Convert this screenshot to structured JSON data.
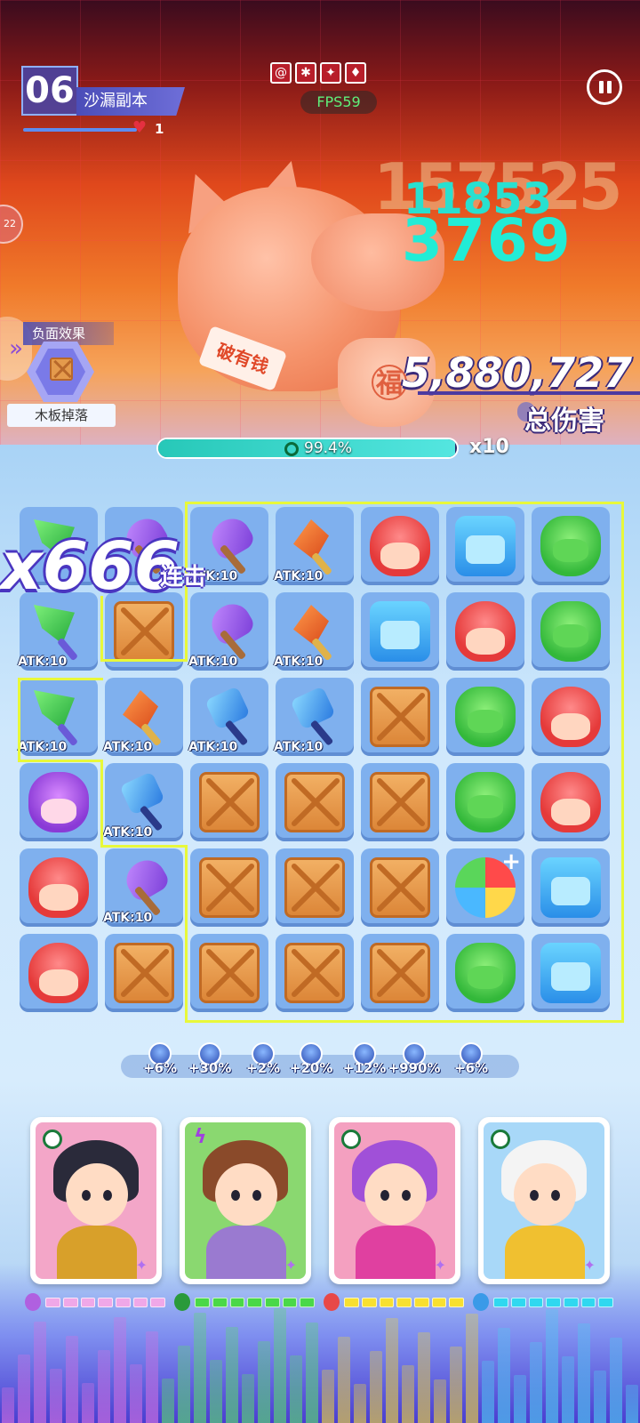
{
  "header": {
    "level_number": "06",
    "stage_name": "沙漏副本",
    "flame_count": "1",
    "element_icons": [
      "tornado-icon",
      "snowflake-icon",
      "fire-burst-icon",
      "flame-icon"
    ],
    "fps": "FPS59",
    "pause_icon": "pause-icon"
  },
  "boss": {
    "scroll_text": "破有钱",
    "bag_text": "福",
    "ghost_damage": "157525",
    "damage_hit_1": "11853",
    "damage_hit_2": "3769",
    "total_damage": "5,880,727",
    "total_damage_label": "总伤害",
    "side_timer": "22"
  },
  "debuff": {
    "title": "负面效果",
    "name": "木板掉落",
    "icon": "wooden-crate-icon"
  },
  "hp": {
    "percent_text": "99.4%",
    "fill_fraction": 0.994,
    "multiplier": "x10"
  },
  "combo": {
    "count": "x666",
    "label": "连击"
  },
  "grid": {
    "rows": [
      [
        {
          "type": "sword-green",
          "atk": ""
        },
        {
          "type": "axe",
          "atk": ""
        },
        {
          "type": "axe",
          "atk": "ATK:10"
        },
        {
          "type": "sword-orange",
          "atk": "ATK:10"
        },
        {
          "type": "red",
          "atk": ""
        },
        {
          "type": "blue",
          "atk": ""
        },
        {
          "type": "green",
          "atk": ""
        }
      ],
      [
        {
          "type": "sword-green",
          "atk": "ATK:10"
        },
        {
          "type": "crate",
          "atk": ""
        },
        {
          "type": "axe",
          "atk": "ATK:10"
        },
        {
          "type": "sword-orange",
          "atk": "ATK:10"
        },
        {
          "type": "blue",
          "atk": ""
        },
        {
          "type": "red",
          "atk": ""
        },
        {
          "type": "green",
          "atk": ""
        }
      ],
      [
        {
          "type": "sword-green",
          "atk": "ATK:10"
        },
        {
          "type": "sword-orange",
          "atk": "ATK:10"
        },
        {
          "type": "hammer",
          "atk": "ATK:10"
        },
        {
          "type": "hammer",
          "atk": "ATK:10"
        },
        {
          "type": "crate",
          "atk": ""
        },
        {
          "type": "green",
          "atk": ""
        },
        {
          "type": "red",
          "atk": ""
        }
      ],
      [
        {
          "type": "purple",
          "atk": ""
        },
        {
          "type": "hammer",
          "atk": "ATK:10"
        },
        {
          "type": "crate",
          "atk": ""
        },
        {
          "type": "crate",
          "atk": ""
        },
        {
          "type": "crate",
          "atk": ""
        },
        {
          "type": "green",
          "atk": ""
        },
        {
          "type": "red",
          "atk": ""
        }
      ],
      [
        {
          "type": "red",
          "atk": ""
        },
        {
          "type": "axe",
          "atk": "ATK:10"
        },
        {
          "type": "crate",
          "atk": ""
        },
        {
          "type": "crate",
          "atk": ""
        },
        {
          "type": "crate",
          "atk": ""
        },
        {
          "type": "ball",
          "atk": ""
        },
        {
          "type": "blue",
          "atk": ""
        }
      ],
      [
        {
          "type": "red",
          "atk": ""
        },
        {
          "type": "crate",
          "atk": ""
        },
        {
          "type": "crate",
          "atk": ""
        },
        {
          "type": "crate",
          "atk": ""
        },
        {
          "type": "crate",
          "atk": ""
        },
        {
          "type": "green",
          "atk": ""
        },
        {
          "type": "blue",
          "atk": ""
        }
      ]
    ]
  },
  "buffs": [
    {
      "icon": "wing-icon",
      "value": "+6%"
    },
    {
      "icon": "shield-boost-icon",
      "value": "+30%"
    },
    {
      "icon": "rainbow-orb-icon",
      "value": "+2%"
    },
    {
      "icon": "plus-orb-icon",
      "value": "+20%"
    },
    {
      "icon": "sword-orb-icon",
      "value": "+12%"
    },
    {
      "icon": "crossed-swords-icon",
      "value": "+990%"
    },
    {
      "icon": "splash-icon",
      "value": "+6%"
    }
  ],
  "heroes": [
    {
      "name_icon": "opera-warrior-avatar",
      "bg": "#f3a6c8",
      "hair": "#2a2a3a",
      "body": "#d8a02a",
      "energy_color": "#f0a8e8",
      "head_color": "#b060e0",
      "segments": 7,
      "badge": "swirl"
    },
    {
      "name_icon": "dino-skull-girl-avatar",
      "bg": "#8ad870",
      "hair": "#8a4a2a",
      "body": "#9a7ad0",
      "energy_color": "#4ad848",
      "head_color": "#2a9a3a",
      "segments": 7,
      "badge": "bolt"
    },
    {
      "name_icon": "purple-maid-girl-avatar",
      "bg": "#f4a0c0",
      "hair": "#a050d8",
      "body": "#e040a0",
      "energy_color": "#f8e030",
      "head_color": "#e84848",
      "segments": 7,
      "badge": "swirl"
    },
    {
      "name_icon": "astronaut-bear-avatar",
      "bg": "#a8d8f8",
      "hair": "#f4f4f4",
      "body": "#f0c030",
      "energy_color": "#30d8f0",
      "head_color": "#3a9ae8",
      "segments": 7,
      "badge": "swirl"
    }
  ]
}
